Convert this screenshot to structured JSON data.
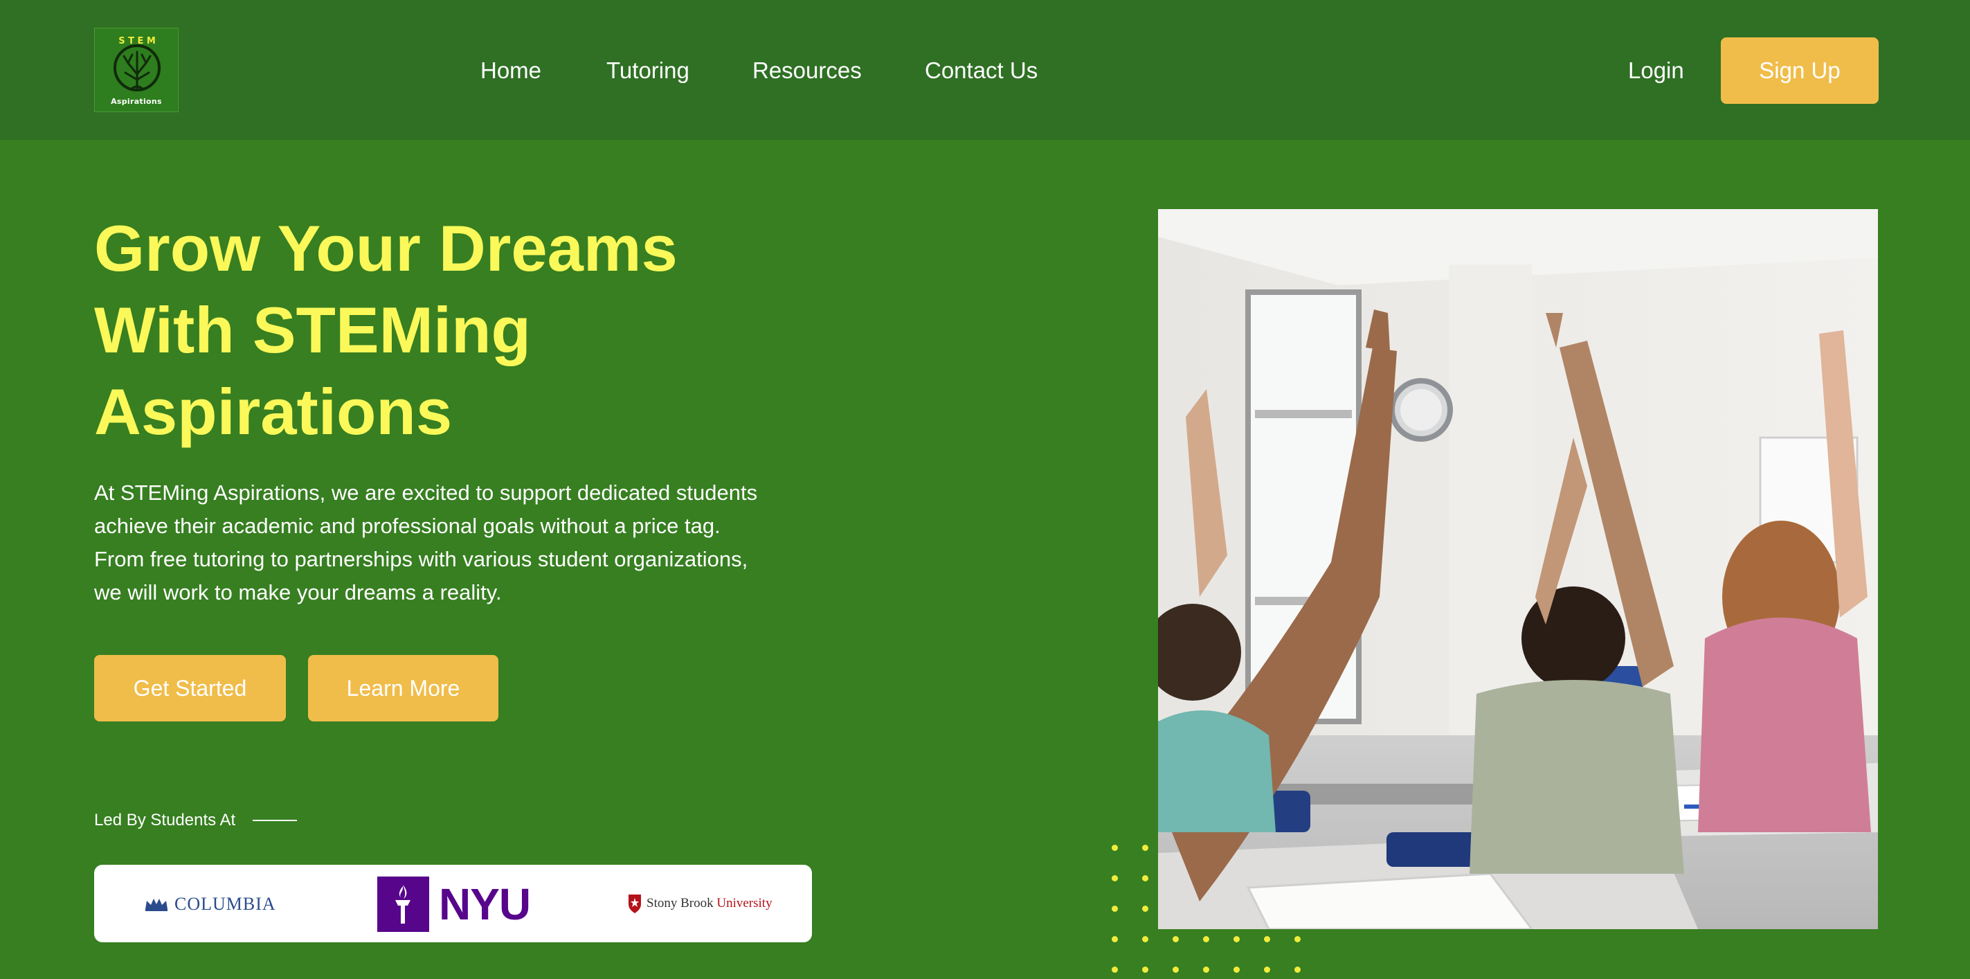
{
  "brand": {
    "logo_top_text": "S T E M",
    "logo_bottom_text": "Aspirations"
  },
  "nav": {
    "links": [
      {
        "label": "Home"
      },
      {
        "label": "Tutoring"
      },
      {
        "label": "Resources"
      },
      {
        "label": "Contact Us"
      }
    ],
    "login_label": "Login",
    "signup_label": "Sign Up"
  },
  "hero": {
    "title_line1": "Grow Your Dreams",
    "title_line2": "With STEMing",
    "title_line3": "Aspirations",
    "description": "At STEMing Aspirations, we are excited to support dedicated students achieve their academic and professional goals without a price tag. From free tutoring to partnerships with various student organizations, we will work to make your dreams a reality.",
    "primary_cta": "Get Started",
    "secondary_cta": "Learn More",
    "led_by_label": "Led By Students At",
    "partners": [
      {
        "name": "COLUMBIA"
      },
      {
        "name": "NYU"
      },
      {
        "name_main": "Stony Brook",
        "name_suffix": "University"
      }
    ]
  },
  "colors": {
    "background": "#377f21",
    "navbar": "#2f7024",
    "accent_button": "#f0bd4a",
    "headline": "#fbf85a",
    "dots": "#f1ec3c"
  },
  "icons": [
    "tree-logo-icon",
    "columbia-crown-icon",
    "nyu-torch-icon",
    "stony-brook-shield-icon"
  ]
}
